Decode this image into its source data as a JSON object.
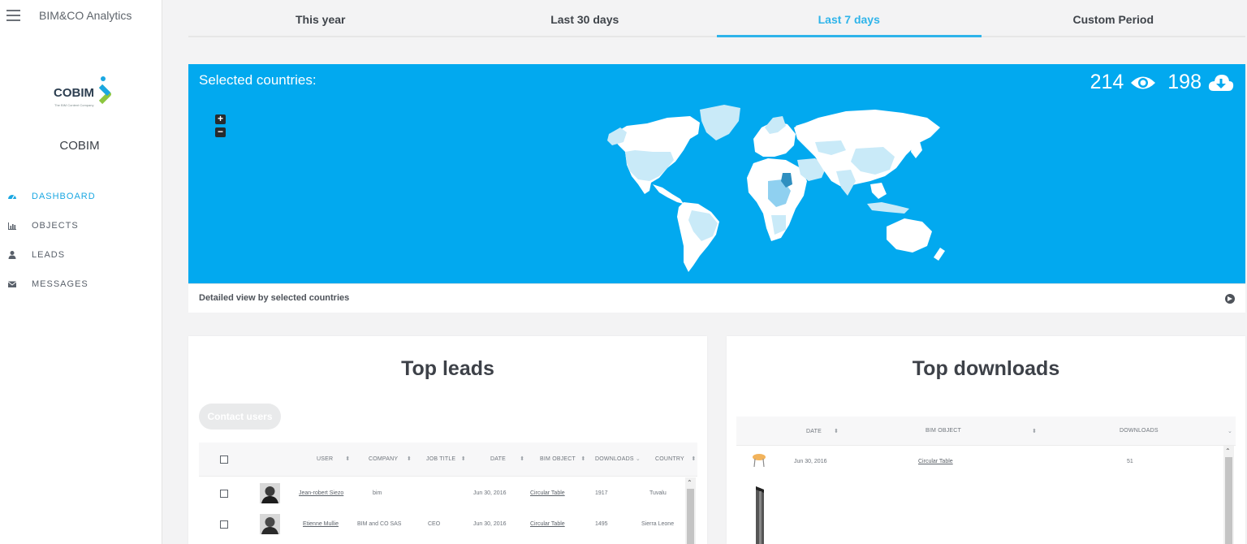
{
  "app": {
    "title": "BIM&CO Analytics"
  },
  "brand": {
    "logo_text": "COBIM",
    "logo_subtitle": "The BIM Content Company",
    "company_name": "COBIM"
  },
  "nav": {
    "items": [
      {
        "label": "DASHBOARD",
        "icon": "dashboard-icon",
        "active": true
      },
      {
        "label": "OBJECTS",
        "icon": "bar-chart-icon",
        "active": false
      },
      {
        "label": "LEADS",
        "icon": "user-icon",
        "active": false
      },
      {
        "label": "MESSAGES",
        "icon": "envelope-icon",
        "active": false
      }
    ]
  },
  "tabs": [
    {
      "label": "This year",
      "active": false
    },
    {
      "label": "Last 30 days",
      "active": false
    },
    {
      "label": "Last 7 days",
      "active": true
    },
    {
      "label": "Custom Period",
      "active": false
    }
  ],
  "map": {
    "title": "Selected countries:",
    "views": "214",
    "downloads": "198",
    "zoom_in": "+",
    "zoom_out": "−",
    "footer_link": "Detailed view by selected countries",
    "colors": {
      "background": "#02a9ef",
      "land": "#ffffff",
      "light": "#c9eaf8",
      "medium": "#8fd0f0",
      "dark": "#2f8fc0"
    }
  },
  "top_leads": {
    "title": "Top leads",
    "contact_button": "Contact users",
    "columns": [
      "USER",
      "COMPANY",
      "JOB TITLE",
      "DATE",
      "BIM OBJECT",
      "DOWNLOADS",
      "COUNTRY"
    ],
    "rows": [
      {
        "user": "Jean-robert Siezo",
        "company": "bim",
        "job_title": "",
        "date": "Jun 30, 2016",
        "bim_object": "Circular Table",
        "downloads": "1917",
        "country": "Tuvalu"
      },
      {
        "user": "Etienne Mullie",
        "company": "BIM and CO SAS",
        "job_title": "CEO",
        "date": "Jun 30, 2016",
        "bim_object": "Circular Table",
        "downloads": "1495",
        "country": "Sierra Leone"
      }
    ]
  },
  "top_downloads": {
    "title": "Top downloads",
    "columns": [
      "DATE",
      "BIM OBJECT",
      "DOWNLOADS"
    ],
    "rows": [
      {
        "date": "Jun 30, 2016",
        "bim_object": "Circular Table",
        "downloads": "51"
      }
    ]
  }
}
